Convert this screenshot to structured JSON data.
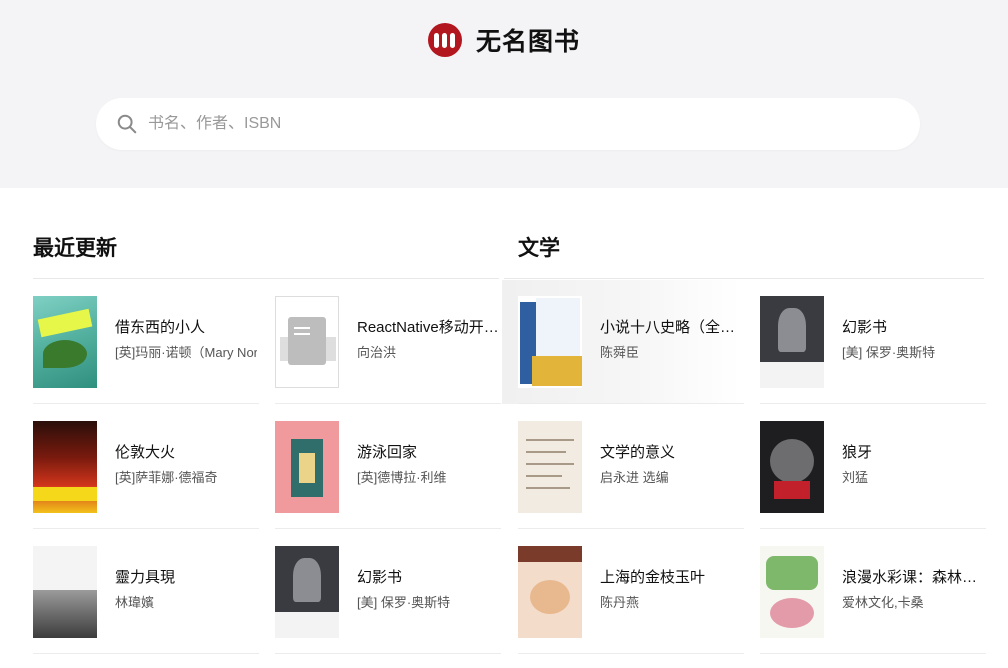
{
  "header": {
    "brand_title": "无名图书",
    "search_placeholder": "书名、作者、ISBN"
  },
  "sections": [
    {
      "title": "最近更新",
      "books": [
        {
          "title": "借东西的小人",
          "author": "[英]玛丽·诺顿（Mary Norton）",
          "cover": "teal"
        },
        {
          "title": "ReactNative移动开发实战",
          "author": "向治洪",
          "cover": "gray"
        },
        {
          "title": "伦敦大火",
          "author": "[英]萨菲娜·德福奇",
          "cover": "fire"
        },
        {
          "title": "游泳回家",
          "author": "[英]德博拉·利维",
          "cover": "pink"
        },
        {
          "title": "靈力具現",
          "author": "林瑋嬪",
          "cover": "bw"
        },
        {
          "title": "幻影书",
          "author": "[美] 保罗·奥斯特",
          "cover": "dark"
        }
      ]
    },
    {
      "title": "文学",
      "books": [
        {
          "title": "小说十八史略（全六册）",
          "author": "陈舜臣",
          "cover": "gold"
        },
        {
          "title": "幻影书",
          "author": "[美] 保罗·奥斯特",
          "cover": "dark"
        },
        {
          "title": "文学的意义",
          "author": "启永进 选编",
          "cover": "paper"
        },
        {
          "title": "狼牙",
          "author": "刘猛",
          "cover": "wolf"
        },
        {
          "title": "上海的金枝玉叶",
          "author": "陈丹燕",
          "cover": "peach"
        },
        {
          "title": "浪漫水彩课：森林系手绘插画",
          "author": "爱林文化,卡桑",
          "cover": "green"
        }
      ]
    }
  ],
  "colors": {
    "brand": "#b2161f",
    "header_bg": "#f4f4f6"
  }
}
